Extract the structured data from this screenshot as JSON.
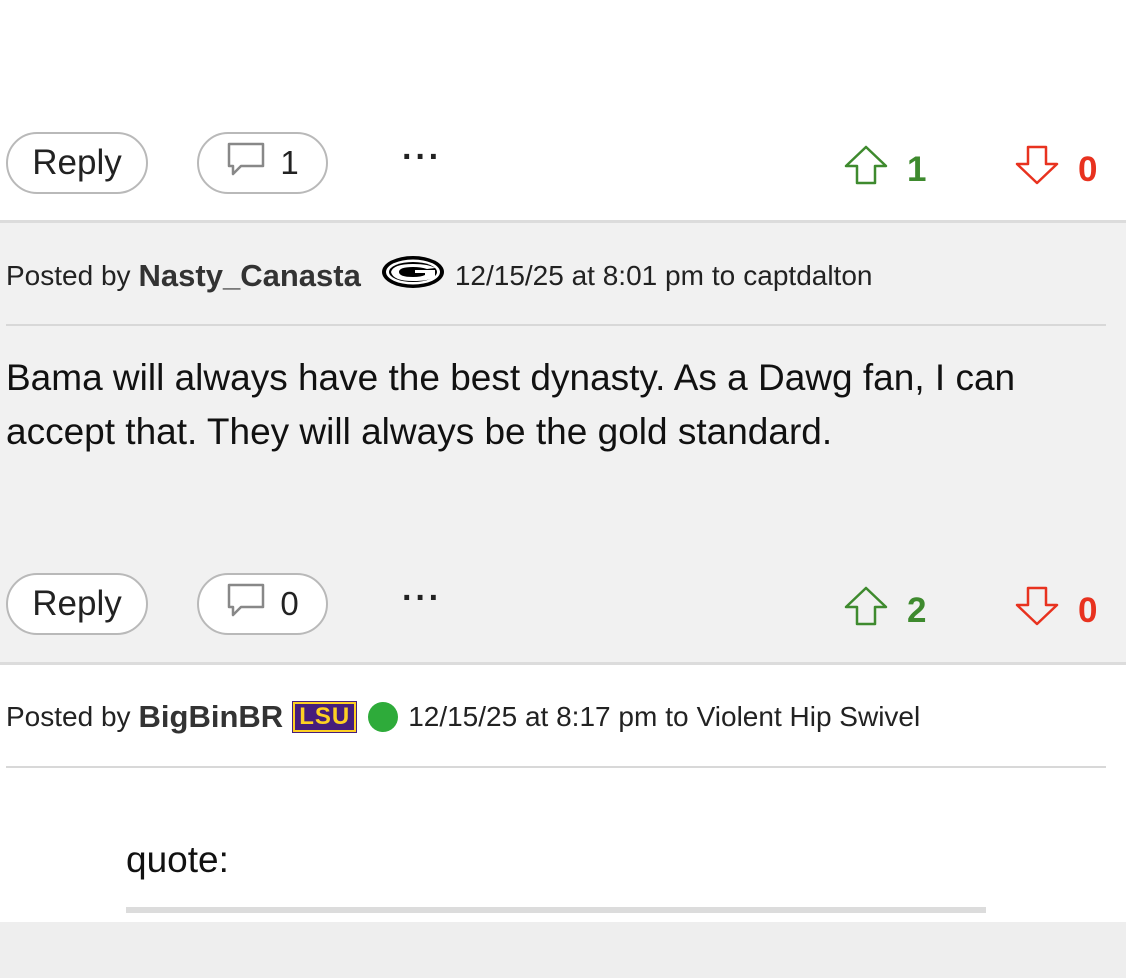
{
  "posts": [
    {
      "actions": {
        "reply_label": "Reply",
        "comment_count": "1",
        "more_label": "···",
        "upvotes": "1",
        "downvotes": "0"
      }
    },
    {
      "header": {
        "posted_by": "Posted by",
        "author": "Nasty_Canasta",
        "team": "Georgia Bulldogs (G logo)",
        "timestamp": "12/15/25 at 8:01 pm",
        "to_label": "to",
        "reply_to": "captdalton"
      },
      "body": "Bama will always have the best dynasty. As a Dawg fan, I can accept that. They will always be the gold standard.",
      "actions": {
        "reply_label": "Reply",
        "comment_count": "0",
        "more_label": "···",
        "upvotes": "2",
        "downvotes": "0"
      }
    },
    {
      "header": {
        "posted_by": "Posted by",
        "author": "BigBinBR",
        "team_logo_text": "LSU",
        "online": true,
        "timestamp": "12/15/25 at 8:17 pm",
        "to_label": "to",
        "reply_to": "Violent Hip Swivel"
      },
      "quote_label": "quote:"
    }
  ],
  "colors": {
    "upvote": "#3e8a2e",
    "downvote": "#e8321f",
    "post_bg_alt": "#f1f1f1",
    "online": "#2eab3a"
  }
}
